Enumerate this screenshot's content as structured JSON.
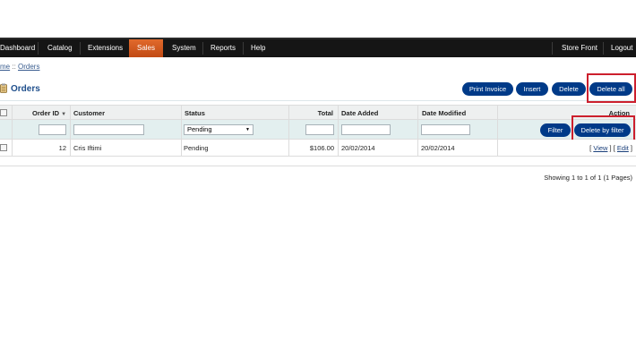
{
  "menu": {
    "items": [
      {
        "label": "Dashboard"
      },
      {
        "label": "Catalog"
      },
      {
        "label": "Extensions"
      },
      {
        "label": "Sales"
      },
      {
        "label": "System"
      },
      {
        "label": "Reports"
      },
      {
        "label": "Help"
      }
    ],
    "active": "Sales",
    "right": [
      {
        "label": "Store Front"
      },
      {
        "label": "Logout"
      }
    ]
  },
  "breadcrumb": {
    "home": "me",
    "separator": " :: ",
    "current": "Orders"
  },
  "page": {
    "title": "Orders",
    "icon": "clipboard-icon"
  },
  "toolbar": {
    "print_invoice": "Print Invoice",
    "insert": "Insert",
    "delete": "Delete",
    "delete_all": "Delete all"
  },
  "table": {
    "headers": {
      "order_id": "Order ID",
      "customer": "Customer",
      "status": "Status",
      "total": "Total",
      "date_added": "Date Added",
      "date_modified": "Date Modified",
      "action": "Action"
    },
    "sort_indicator": "sort-down-icon",
    "filter": {
      "status_value": "Pending",
      "filter_button": "Filter",
      "delete_by_filter_button": "Delete by filter"
    },
    "rows": [
      {
        "order_id": "12",
        "customer": "Cris Iftimi",
        "status": "Pending",
        "total": "$106.00",
        "date_added": "20/02/2014",
        "date_modified": "20/02/2014",
        "action": {
          "open": "[ ",
          "view": "View",
          "mid": " ] [ ",
          "edit": "Edit",
          "close": " ]"
        }
      }
    ]
  },
  "pagination": {
    "text": "Showing 1 to 1 of 1 (1 Pages)"
  },
  "colors": {
    "menu_bg": "#151515",
    "active_tab": "#d4581f",
    "button": "#003a88",
    "title": "#1f4f8c",
    "highlight_box": "#cc1f2d"
  }
}
